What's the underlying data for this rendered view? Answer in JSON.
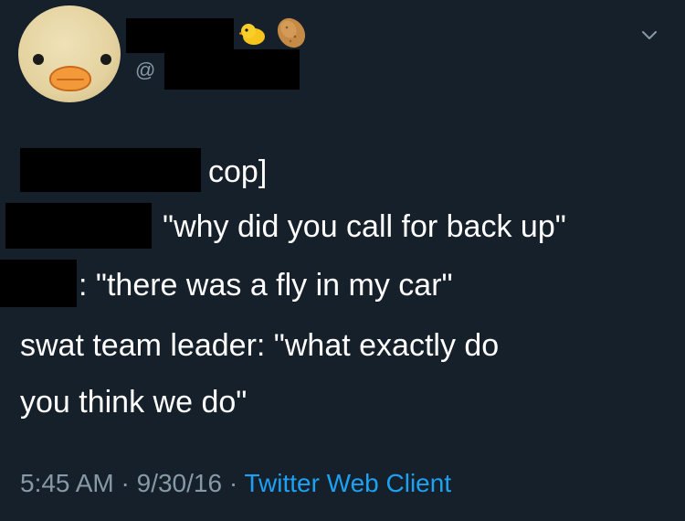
{
  "user": {
    "handle_prefix": "@"
  },
  "tweet": {
    "lines": [
      "cop]",
      "\"why did you call for back up\"",
      ": \"there was a fly in my car\"",
      "swat team leader: \"what exactly do",
      "you think we do\""
    ],
    "time": "5:45 AM",
    "date": "9/30/16",
    "separator": "·",
    "client": "Twitter Web Client"
  },
  "colors": {
    "background": "#16202b",
    "text": "#ffffff",
    "muted": "#8899a6",
    "link": "#1da1f2"
  },
  "icons": {
    "avatar": "duck-face-avatar",
    "emoji_1": "baby-chick-emoji",
    "emoji_2": "potato-emoji",
    "menu": "chevron-down-icon"
  }
}
